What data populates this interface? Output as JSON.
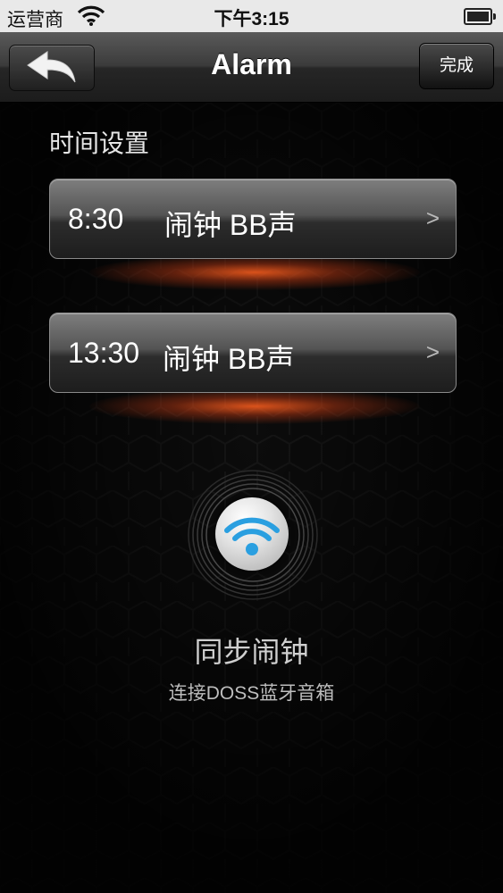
{
  "status_bar": {
    "carrier": "运营商",
    "time": "下午3:15"
  },
  "nav": {
    "title": "Alarm",
    "done_label": "完成"
  },
  "section": {
    "title": "时间设置"
  },
  "alarms": [
    {
      "time": "8:30",
      "label": "闹钟 BB声"
    },
    {
      "time": "13:30",
      "label": "闹钟 BB声"
    }
  ],
  "chevron": ">",
  "sync": {
    "title": "同步闹钟",
    "subtitle": "连接DOSS蓝牙音箱"
  },
  "colors": {
    "accent_blue": "#2a9fe0",
    "glow_orange": "#ff5f1e"
  }
}
